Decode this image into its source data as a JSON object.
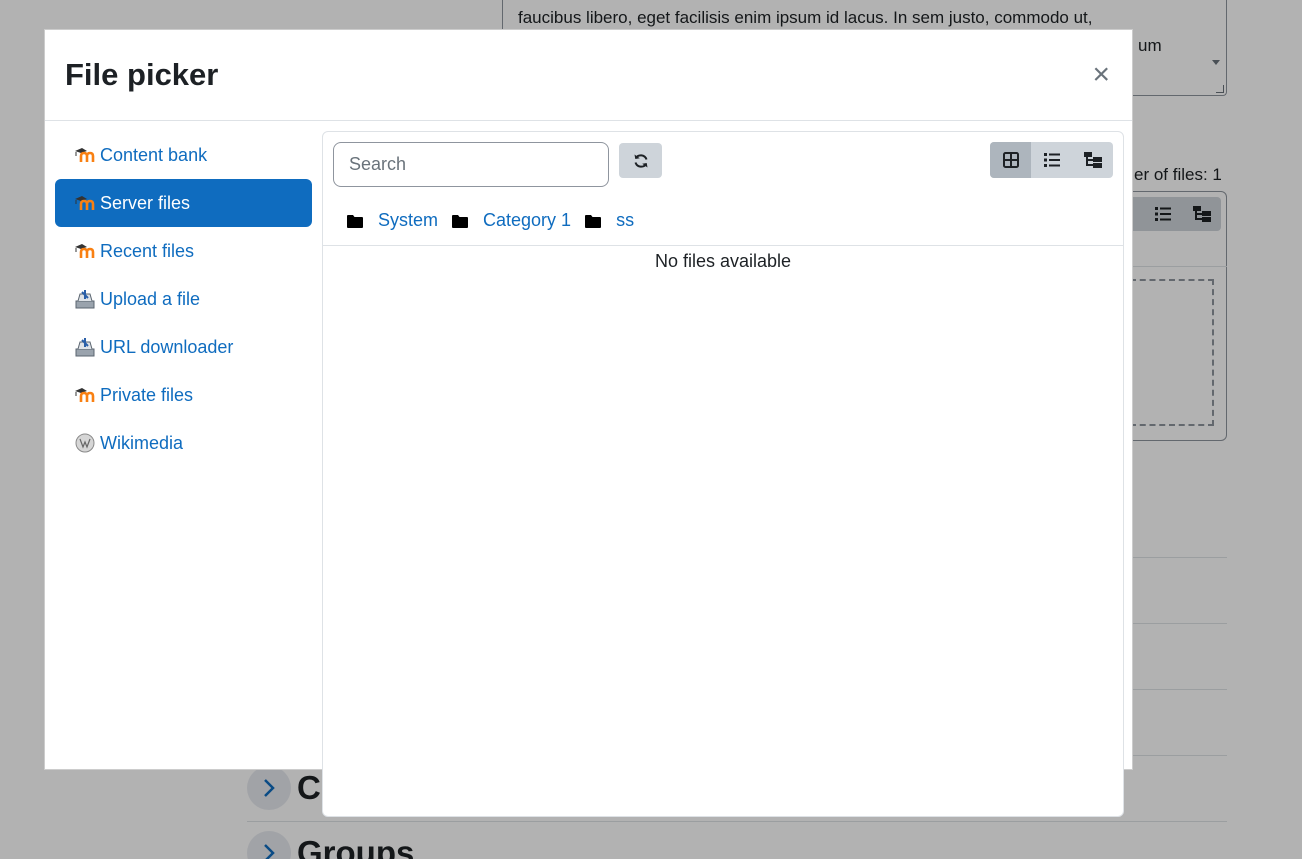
{
  "background": {
    "textarea_line1": "faucibus libero, eget facilisis enim ipsum id lacus. In sem justo, commodo ut,",
    "textarea_line2": "um",
    "file_count": "er of files: 1",
    "section_c": "C",
    "section_groups": "Groups"
  },
  "modal": {
    "title": "File picker",
    "close_label": "×"
  },
  "repositories": [
    {
      "label": "Content bank",
      "icon": "moodle-icon",
      "active": false
    },
    {
      "label": "Server files",
      "icon": "moodle-icon",
      "active": true
    },
    {
      "label": "Recent files",
      "icon": "moodle-icon",
      "active": false
    },
    {
      "label": "Upload a file",
      "icon": "upload-icon",
      "active": false
    },
    {
      "label": "URL downloader",
      "icon": "download-icon",
      "active": false
    },
    {
      "label": "Private files",
      "icon": "moodle-icon",
      "active": false
    },
    {
      "label": "Wikimedia",
      "icon": "wikimedia-icon",
      "active": false
    }
  ],
  "toolbar": {
    "search_placeholder": "Search",
    "refresh_icon": "refresh-icon",
    "views": [
      {
        "name": "icons-view",
        "icon": "grid-icon",
        "active": true
      },
      {
        "name": "list-view",
        "icon": "list-icon",
        "active": false
      },
      {
        "name": "tree-view",
        "icon": "tree-icon",
        "active": false
      }
    ]
  },
  "breadcrumb": [
    "System",
    "Category 1",
    "ss"
  ],
  "content": {
    "empty_message": "No files available"
  },
  "colors": {
    "primary": "#0f6cbf",
    "button_gray": "#ced4da",
    "border": "#dee2e6"
  }
}
